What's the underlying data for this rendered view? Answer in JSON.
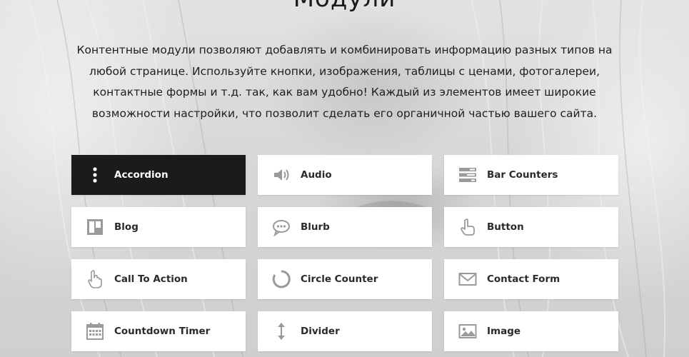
{
  "page": {
    "title": "Модули",
    "intro": "Контентные модули позволяют добавлять и комбинировать информацию разных типов на любой странице. Используйте кнопки, изображения, таблицы с ценами, фотогалереи, контактные формы и т.д. так, как вам удобно! Каждый из элементов имеет широкие возможности настройки, что позволит сделать его органичной частью вашего сайта."
  },
  "colors": {
    "active_card": "#1b1b1b",
    "card": "#ffffff",
    "icon": "#9a9a9a"
  },
  "modules": [
    {
      "label": "Accordion",
      "icon": "vertical-dots-icon",
      "active": true
    },
    {
      "label": "Audio",
      "icon": "speaker-icon",
      "active": false
    },
    {
      "label": "Bar Counters",
      "icon": "bar-counters-icon",
      "active": false
    },
    {
      "label": "Blog",
      "icon": "blog-icon",
      "active": false
    },
    {
      "label": "Blurb",
      "icon": "speech-bubble-icon",
      "active": false
    },
    {
      "label": "Button",
      "icon": "pointer-hand-icon",
      "active": false
    },
    {
      "label": "Call To Action",
      "icon": "tap-hand-icon",
      "active": false
    },
    {
      "label": "Circle Counter",
      "icon": "circle-counter-icon",
      "active": false
    },
    {
      "label": "Contact Form",
      "icon": "envelope-icon",
      "active": false
    },
    {
      "label": "Countdown Timer",
      "icon": "calendar-icon",
      "active": false
    },
    {
      "label": "Divider",
      "icon": "vertical-arrows-icon",
      "active": false
    },
    {
      "label": "Image",
      "icon": "image-icon",
      "active": false
    }
  ]
}
